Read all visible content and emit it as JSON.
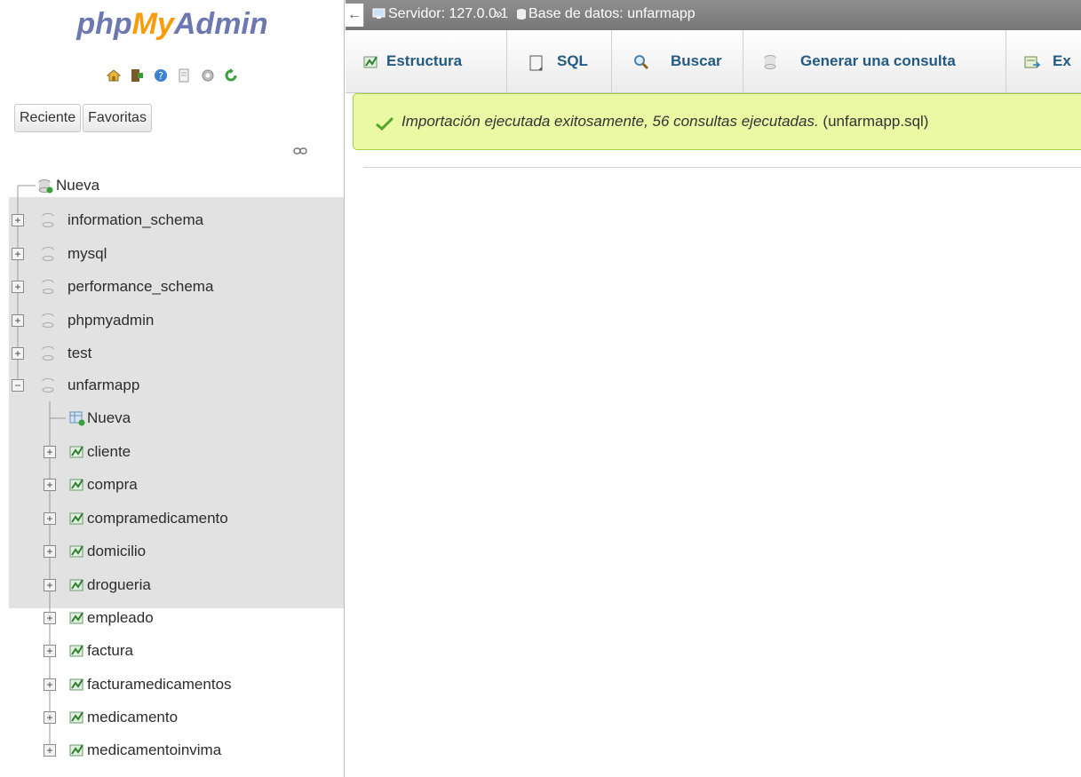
{
  "logo": {
    "part1": "php",
    "part2": "My",
    "part3": "Admin"
  },
  "quick_icons": [
    "home-icon",
    "logout-icon",
    "help-icon",
    "docs-icon",
    "settings-icon",
    "reload-icon"
  ],
  "quick_tabs": {
    "recent": "Reciente",
    "favorites": "Favoritas"
  },
  "tree": {
    "new": "Nueva",
    "databases": [
      "information_schema",
      "mysql",
      "performance_schema",
      "phpmyadmin",
      "test",
      "unfarmapp"
    ],
    "expanded_db": {
      "new": "Nueva",
      "tables": [
        "cliente",
        "compra",
        "compramedicamento",
        "domicilio",
        "drogueria",
        "empleado",
        "factura",
        "facturamedicamentos",
        "medicamento",
        "medicamentoinvima"
      ]
    }
  },
  "breadcrumb": {
    "server": "Servidor: 127.0.0.1",
    "separator": "»",
    "database": "Base de datos: unfarmapp"
  },
  "tabs": [
    "Estructura",
    "SQL",
    "Buscar",
    "Generar una consulta",
    "Ex"
  ],
  "message": {
    "italic": "Importación ejecutada exitosamente, 56 consultas ejecutadas.",
    "file": "(unfarmapp.sql)"
  },
  "colors": {
    "logo_blue": "#6c78af",
    "logo_orange": "#f89c0e",
    "success_bg": "#ebf8a4",
    "tab_text": "#235a81"
  }
}
